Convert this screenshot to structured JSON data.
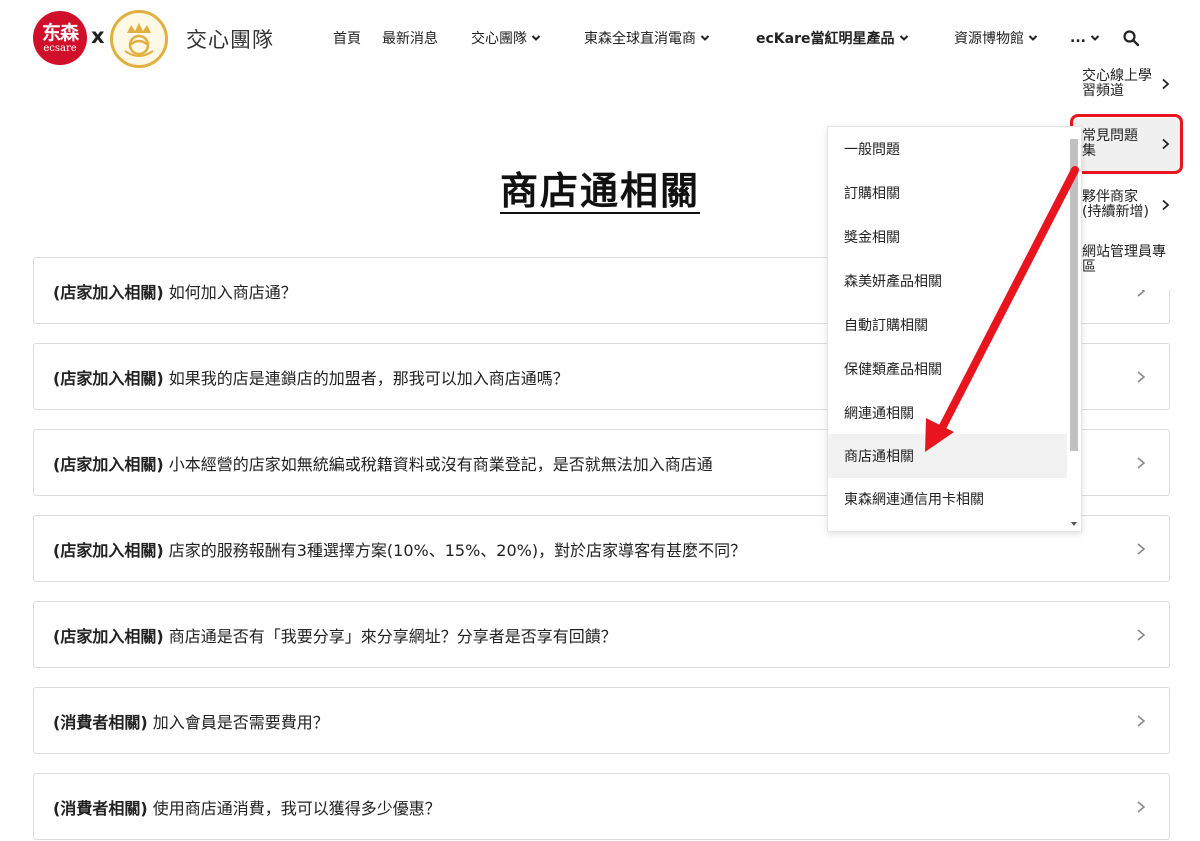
{
  "header": {
    "logo_ecare_zh": "东森",
    "logo_ecare_en": "ecsare",
    "logo_separator": "x",
    "brand": "交心團隊",
    "nav": [
      {
        "label": "首頁",
        "has_chevron": false
      },
      {
        "label": "最新消息",
        "has_chevron": false
      },
      {
        "label": "交心團隊",
        "has_chevron": true
      },
      {
        "label": "東森全球直消電商",
        "has_chevron": true
      },
      {
        "label": "ecKare當紅明星產品",
        "has_chevron": true
      },
      {
        "label": "資源博物館",
        "has_chevron": true
      },
      {
        "label": "...",
        "has_chevron": true
      }
    ],
    "search_icon": "search-icon"
  },
  "page": {
    "title": "商店通相關"
  },
  "faqs": [
    {
      "tag": "(店家加入相關)",
      "text": " 如何加入商店通？"
    },
    {
      "tag": "(店家加入相關)",
      "text": " 如果我的店是連鎖店的加盟者，那我可以加入商店通嗎？"
    },
    {
      "tag": "(店家加入相關)",
      "text": " 小本經營的店家如無統編或稅籍資料或沒有商業登記，是否就無法加入商店通"
    },
    {
      "tag": "(店家加入相關)",
      "text": " 店家的服務報酬有3種選擇方案(10%、15%、20%)，對於店家導客有甚麼不同？"
    },
    {
      "tag": "(店家加入相關)",
      "text": " 商店通是否有「我要分享」來分享網址？分享者是否享有回饋？"
    },
    {
      "tag": "(消費者相關)",
      "text": " 加入會員是否需要費用？"
    },
    {
      "tag": "(消費者相關)",
      "text": " 使用商店通消費，我可以獲得多少優惠？"
    }
  ],
  "submenu_level1": [
    {
      "line1": "交心線上學",
      "line2": "習頻道"
    },
    {
      "line1": "常見問題",
      "line2": "集"
    },
    {
      "line1": "夥伴商家",
      "line2": "(持續新增)"
    },
    {
      "line1": "網站管理員專",
      "line2": "區"
    }
  ],
  "submenu_level2": [
    "一般問題",
    "訂購相關",
    "獎金相關",
    "森美妍產品相關",
    "自動訂購相關",
    "保健類產品相關",
    "網連通相關",
    "商店通相關",
    "東森網連通信用卡相關"
  ],
  "submenu_level2_active_index": 7,
  "colors": {
    "accent_red": "#e8141e",
    "ecare_red": "#d0102a",
    "crest_gold": "#e0b040"
  }
}
